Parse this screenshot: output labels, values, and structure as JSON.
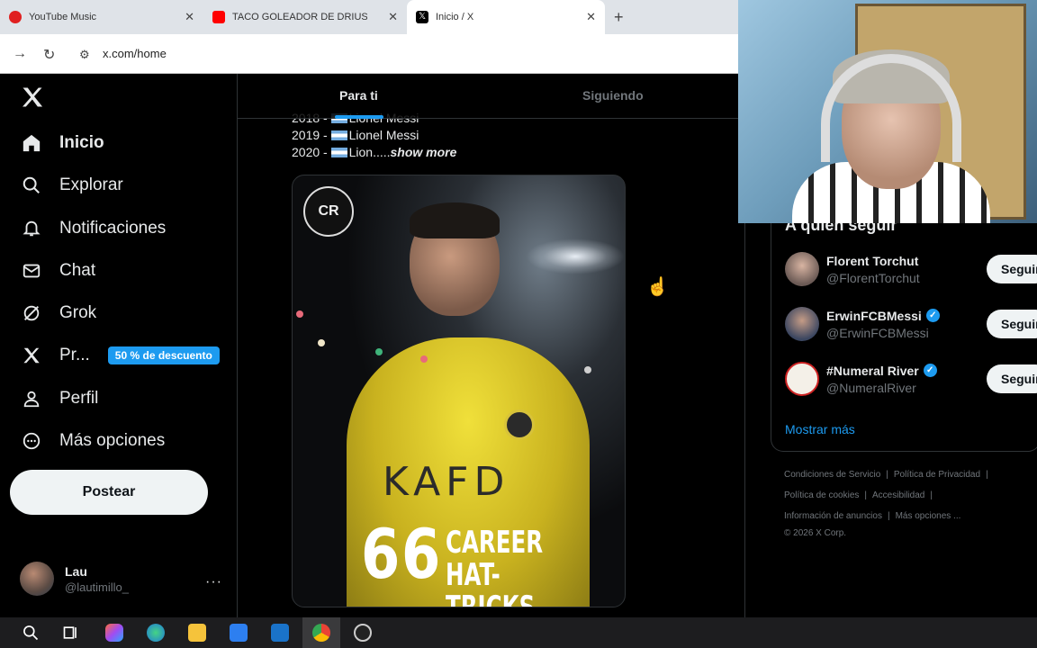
{
  "browser": {
    "tabs": [
      {
        "title": "YouTube Music",
        "favicon": "youtube-music-icon",
        "color": "#e02020"
      },
      {
        "title": "TACO GOLEADOR DE DRIUSSI Y",
        "favicon": "youtube-icon",
        "color": "#ff0000"
      },
      {
        "title": "Inicio / X",
        "favicon": "x-icon",
        "color": "#000000"
      }
    ],
    "url": "x.com/home"
  },
  "sidebar": {
    "items": [
      {
        "label": "Inicio",
        "icon": "home-icon"
      },
      {
        "label": "Explorar",
        "icon": "search-icon"
      },
      {
        "label": "Notificaciones",
        "icon": "bell-icon"
      },
      {
        "label": "Chat",
        "icon": "mail-icon"
      },
      {
        "label": "Grok",
        "icon": "grok-icon"
      },
      {
        "label": "Pr...",
        "icon": "x-icon",
        "badge": "50 % de descuento"
      },
      {
        "label": "Perfil",
        "icon": "person-icon"
      },
      {
        "label": "Más opciones",
        "icon": "more-circle-icon"
      }
    ],
    "post_button": "Postear",
    "account": {
      "name": "Lau",
      "handle": "@lautimillo_",
      "more": "···"
    }
  },
  "feed": {
    "tabs": [
      "Para ti",
      "Siguiendo"
    ],
    "post_lines": [
      "2018 - ",
      "2019 - ",
      "2020 - "
    ],
    "post_names": [
      "Lionel Messi",
      "Lionel Messi",
      "Lion....."
    ],
    "show_more": "show more",
    "media": {
      "number": "66",
      "line1": "CAREER",
      "line2": "HAT-TRICKS",
      "sponsor": "KAFD",
      "badge": "CR"
    }
  },
  "who_to_follow": {
    "title": "A quién seguir",
    "accounts": [
      {
        "name": "Florent Torchut",
        "handle": "@FlorentTorchut",
        "verified": false,
        "button": "Seguir"
      },
      {
        "name": "ErwinFCBMessi",
        "handle": "@ErwinFCBMessi",
        "verified": true,
        "button": "Seguir"
      },
      {
        "name": "#Numeral River",
        "handle": "@NumeralRiver",
        "verified": true,
        "button": "Seguir"
      }
    ],
    "show_more": "Mostrar más"
  },
  "footer": {
    "links": [
      "Condiciones de Servicio",
      "Política de Privacidad",
      "Política de cookies",
      "Accesibilidad",
      "Información de anuncios",
      "Más opciones ..."
    ],
    "copyright": "© 2026 X Corp."
  },
  "colors": {
    "accent": "#1d9bf0",
    "background": "#000000"
  }
}
